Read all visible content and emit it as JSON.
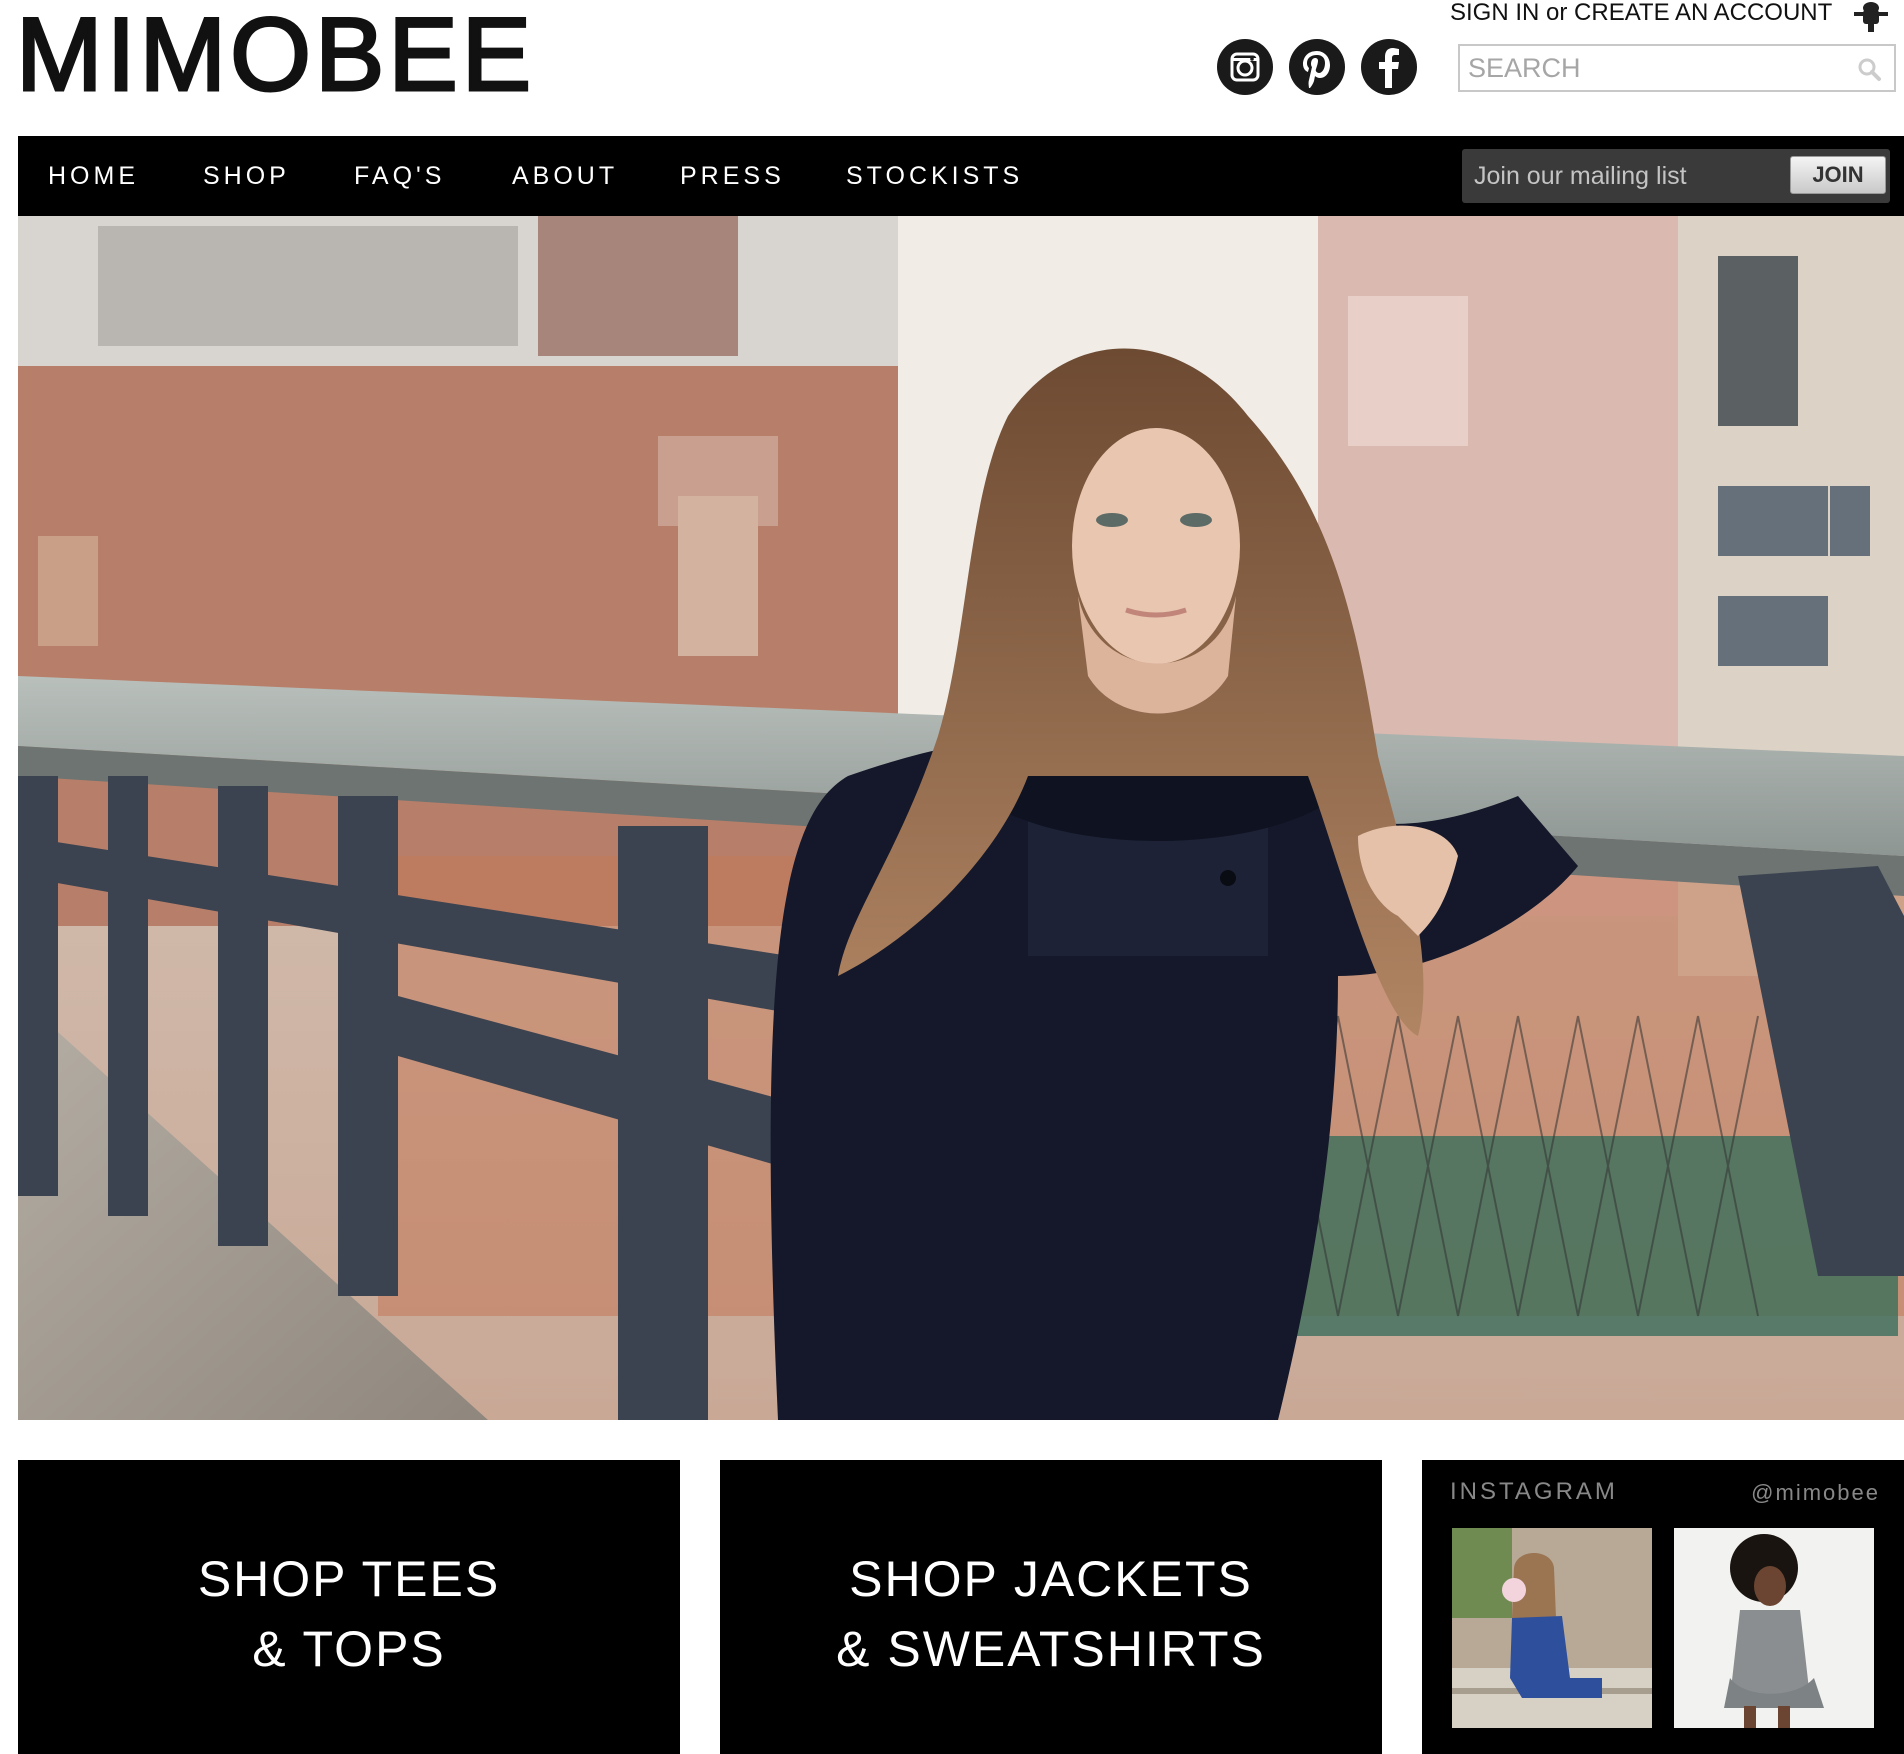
{
  "header": {
    "logo": "MIMOBEE",
    "sign_in": "SIGN IN",
    "or": " or ",
    "create_account": "CREATE AN ACCOUNT",
    "search_placeholder": "SEARCH",
    "social_icons": [
      "instagram-icon",
      "pinterest-icon",
      "facebook-icon"
    ]
  },
  "nav": {
    "items": [
      "HOME",
      "SHOP",
      "FAQ'S",
      "ABOUT",
      "PRESS",
      "STOCKISTS"
    ],
    "mailing_placeholder": "Join our mailing list",
    "join_label": "JOIN"
  },
  "tiles": [
    {
      "label": "SHOP TEES\n& TOPS"
    },
    {
      "label": "SHOP JACKETS\n& SWEATSHIRTS"
    }
  ],
  "instagram": {
    "title": "INSTAGRAM",
    "handle": "@mimobee"
  },
  "colors": {
    "nav_bg": "#000000",
    "mail_bg": "#3a3a3a"
  }
}
